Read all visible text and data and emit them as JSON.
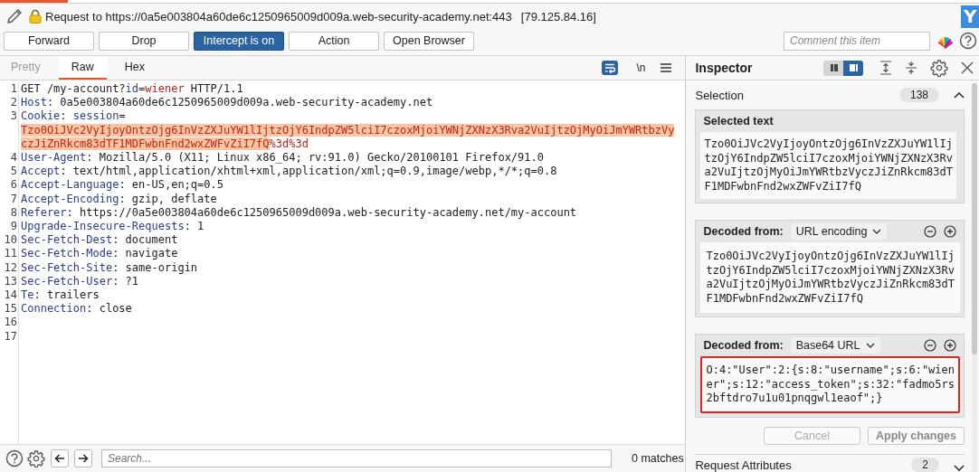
{
  "header": {
    "title": "Request to https://0a5e003804a60de6c1250965009d009a.web-security-academy.net:443",
    "ip": "[79.125.84.16]",
    "logo": "Y"
  },
  "toolbar_buttons": [
    {
      "label": "Forward",
      "selected": false
    },
    {
      "label": "Drop",
      "selected": false
    },
    {
      "label": "Intercept is on",
      "selected": true
    },
    {
      "label": "Action",
      "selected": false
    },
    {
      "label": "Open Browser",
      "selected": false
    }
  ],
  "comment": {
    "placeholder": "Comment this item"
  },
  "editor": {
    "tabs": [
      {
        "label": "Pretty",
        "selected": false,
        "disabled": true
      },
      {
        "label": "Raw",
        "selected": true,
        "disabled": false
      },
      {
        "label": "Hex",
        "selected": false,
        "disabled": false
      }
    ],
    "word_wrap": true,
    "newline_button": "\\n",
    "lines": [
      {
        "number": "1",
        "parts": [
          {
            "text": "GET /my-account?",
            "kind": "plain"
          },
          {
            "text": "id",
            "kind": "name"
          },
          {
            "text": "=",
            "kind": "plain"
          },
          {
            "text": "wiener",
            "kind": "value"
          },
          {
            "text": " HTTP/1.1",
            "kind": "plain"
          }
        ]
      },
      {
        "number": "2",
        "parts": [
          {
            "text": "Host",
            "kind": "name"
          },
          {
            "text": ": 0a5e003804a60de6c1250965009d009a.web-security-academy.net",
            "kind": "plain"
          }
        ]
      },
      {
        "number": "3",
        "parts": [
          {
            "text": "Cookie",
            "kind": "name"
          },
          {
            "text": ": ",
            "kind": "plain"
          },
          {
            "text": "session",
            "kind": "name"
          },
          {
            "text": "=",
            "kind": "plain"
          }
        ],
        "wrapped_parts": [
          {
            "text": "Tzo0OiJVc2VyIjoyOntzOjg6InVzZXJuYW1lIjtzOjY6IndpZW5lciI7czoxMjoiYWNjZXNzX3Rva2VuIjtzOjMyOiJmYWRtbzVyczJiZnRkcm83dTF1MDFwbnFnd2wxZWFvZiI7fQ",
            "kind": "selected"
          },
          {
            "text": "%3d%3d",
            "kind": "value"
          }
        ]
      },
      {
        "number": "4",
        "parts": [
          {
            "text": "User-Agent",
            "kind": "name"
          },
          {
            "text": ": Mozilla/5.0 (X11; Linux x86_64; rv:91.0) Gecko/20100101 Firefox/91.0",
            "kind": "plain"
          }
        ]
      },
      {
        "number": "5",
        "parts": [
          {
            "text": "Accept",
            "kind": "name"
          },
          {
            "text": ": text/html,application/xhtml+xml,application/xml;q=0.9,image/webp,*/*;q=0.8",
            "kind": "plain"
          }
        ]
      },
      {
        "number": "6",
        "parts": [
          {
            "text": "Accept-Language",
            "kind": "name"
          },
          {
            "text": ": en-US,en;q=0.5",
            "kind": "plain"
          }
        ]
      },
      {
        "number": "7",
        "parts": [
          {
            "text": "Accept-Encoding",
            "kind": "name"
          },
          {
            "text": ": gzip, deflate",
            "kind": "plain"
          }
        ]
      },
      {
        "number": "8",
        "parts": [
          {
            "text": "Referer",
            "kind": "name"
          },
          {
            "text": ": https://0a5e003804a60de6c1250965009d009a.web-security-academy.net/my-account",
            "kind": "plain"
          }
        ]
      },
      {
        "number": "9",
        "parts": [
          {
            "text": "Upgrade-Insecure-Requests",
            "kind": "name"
          },
          {
            "text": ": 1",
            "kind": "plain"
          }
        ]
      },
      {
        "number": "10",
        "parts": [
          {
            "text": "Sec-Fetch-Dest",
            "kind": "name"
          },
          {
            "text": ": document",
            "kind": "plain"
          }
        ]
      },
      {
        "number": "11",
        "parts": [
          {
            "text": "Sec-Fetch-Mode",
            "kind": "name"
          },
          {
            "text": ": navigate",
            "kind": "plain"
          }
        ]
      },
      {
        "number": "12",
        "parts": [
          {
            "text": "Sec-Fetch-Site",
            "kind": "name"
          },
          {
            "text": ": same-origin",
            "kind": "plain"
          }
        ]
      },
      {
        "number": "13",
        "parts": [
          {
            "text": "Sec-Fetch-User",
            "kind": "name"
          },
          {
            "text": ": ?1",
            "kind": "plain"
          }
        ]
      },
      {
        "number": "14",
        "parts": [
          {
            "text": "Te",
            "kind": "name"
          },
          {
            "text": ": trailers",
            "kind": "plain"
          }
        ]
      },
      {
        "number": "15",
        "parts": [
          {
            "text": "Connection",
            "kind": "name"
          },
          {
            "text": ": close",
            "kind": "plain"
          }
        ]
      },
      {
        "number": "16"
      },
      {
        "number": "17"
      }
    ]
  },
  "search": {
    "placeholder": "Search...",
    "matches": "0 matches"
  },
  "inspector": {
    "title": "Inspector",
    "view_modes": [
      {
        "selected": false
      },
      {
        "selected": true
      }
    ],
    "selection": {
      "label": "Selection",
      "count": "138",
      "expanded": true
    },
    "selected_text": {
      "heading": "Selected text",
      "value": "Tzo0OiJVc2VyIjoyOntzOjg6InVzZXJuYW1lIjtzOjY6IndpZW5lciI7czoxMjoiYWNjZXNzX3Rva2VuIjtzOjMyOiJmYWRtbzVyczJiZnRkcm83dTF1MDFwbnFnd2wxZWFvZiI7fQ"
    },
    "decoders": [
      {
        "label": "Decoded from:",
        "encoding": "URL encoding",
        "value": "Tzo0OiJVc2VyIjoyOntzOjg6InVzZXJuYW1lIjtzOjY6IndpZW5lciI7czoxMjoiYWNjZXNzX3Rva2VuIjtzOjMyOiJmYWRtbzVyczJiZnRkcm83dTF1MDFwbnFnd2wxZWFvZiI7fQ",
        "outlined": false
      },
      {
        "label": "Decoded from:",
        "encoding": "Base64 URL",
        "value": "O:4:\"User\":2:{s:8:\"username\";s:6:\"wiener\";s:12:\"access_token\";s:32:\"fadmo5rs2bftdro7u1u01pnqgwl1eaof\";}",
        "outlined": true
      }
    ],
    "actions": [
      {
        "label": "Cancel",
        "kind": "secondary"
      },
      {
        "label": "Apply changes",
        "kind": "primary"
      }
    ],
    "request_attributes": {
      "label": "Request Attributes",
      "count": "2",
      "expanded": false
    }
  }
}
